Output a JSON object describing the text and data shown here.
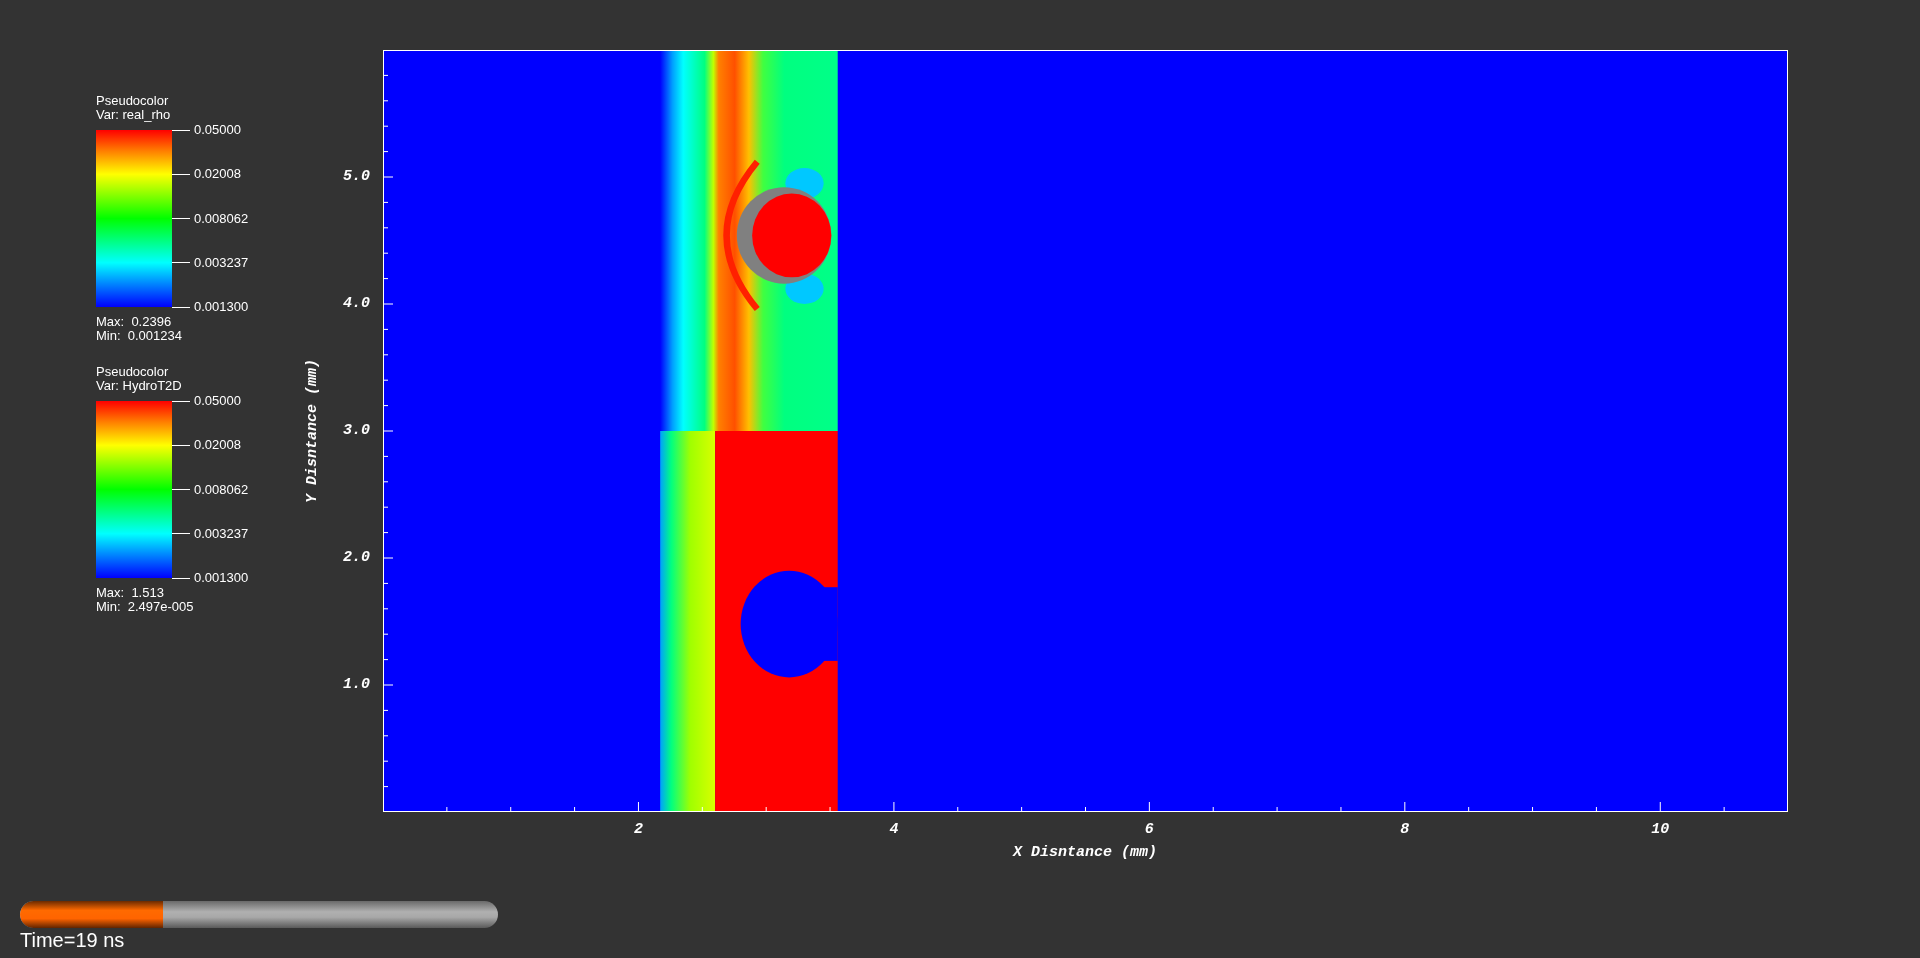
{
  "legends": [
    {
      "title": "Pseudocolor",
      "variable": "Var: real_rho",
      "ticks": [
        "0.05000",
        "0.02008",
        "0.008062",
        "0.003237",
        "0.001300"
      ],
      "max": "Max:  0.2396",
      "min": "Min:  0.001234"
    },
    {
      "title": "Pseudocolor",
      "variable": "Var: HydroT2D",
      "ticks": [
        "0.05000",
        "0.02008",
        "0.008062",
        "0.003237",
        "0.001300"
      ],
      "max": "Max:  1.513",
      "min": "Min:  2.497e-005"
    }
  ],
  "plot": {
    "xlabel": "X Disntance (mm)",
    "ylabel": "Y Disntance (mm)",
    "xticks": [
      "2",
      "4",
      "6",
      "8",
      "10"
    ],
    "yticks": [
      "5.0",
      "4.0",
      "3.0",
      "2.0",
      "1.0"
    ]
  },
  "time_slider": {
    "level": 0.3,
    "label": "Time=19 ns"
  }
}
